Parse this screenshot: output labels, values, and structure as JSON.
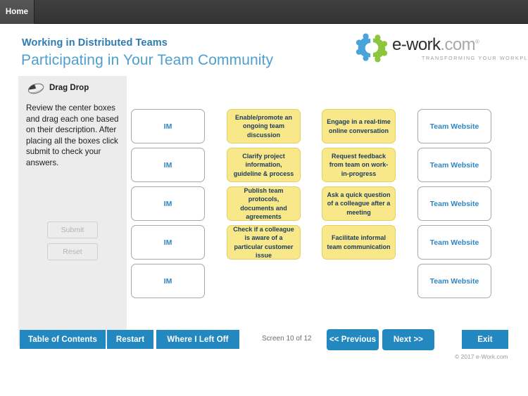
{
  "topbar": {
    "home_label": "Home"
  },
  "header": {
    "course_title": "Working in Distributed Teams",
    "screen_title": "Participating in Your Team Community"
  },
  "logo": {
    "word_main": "e-work",
    "word_suffix": ".com",
    "registered": "®",
    "tagline": "TRANSFORMING YOUR WORKPLACE",
    "mark_blue": "#4aa3da",
    "mark_green": "#8cc63f"
  },
  "instructions": {
    "icon": "mouse-icon",
    "heading": "Drag Drop",
    "body": "Review the center boxes and drag each one based on their description. After placing all the boxes click submit to check your answers.",
    "submit_label": "Submit",
    "reset_label": "Reset",
    "buttons_disabled": true
  },
  "activity": {
    "target_left_label": "IM",
    "target_right_label": "Team Website",
    "rows": 5,
    "targets_left": [
      "IM",
      "IM",
      "IM",
      "IM",
      "IM"
    ],
    "targets_right": [
      "Team Website",
      "Team Website",
      "Team Website",
      "Team Website",
      "Team Website"
    ],
    "cards_col1": [
      "Enable/promote an ongoing team discussion",
      "Clarify project information, guideline & process",
      "Publish team protocols, documents and agreements",
      "Check if a colleague is aware of a particular customer issue"
    ],
    "cards_col2": [
      "Engage in a real-time online conversation",
      "Request feedback from team on work-in-progress",
      "Ask a quick question of a colleague after a meeting",
      "Facilitate informal team communication"
    ],
    "card_color": "#f9e88a",
    "target_text_color": "#2f86c2"
  },
  "nav": {
    "toc_label": "Table of Contents",
    "restart_label": "Restart",
    "left_off_label": "Where I Left Off",
    "screen_counter": "Screen 10 of 12",
    "previous_label": "<< Previous",
    "next_label": "Next >>",
    "exit_label": "Exit",
    "accent_color": "#2288bf"
  },
  "footer": {
    "copyright": "© 2017 e-Work.com"
  }
}
